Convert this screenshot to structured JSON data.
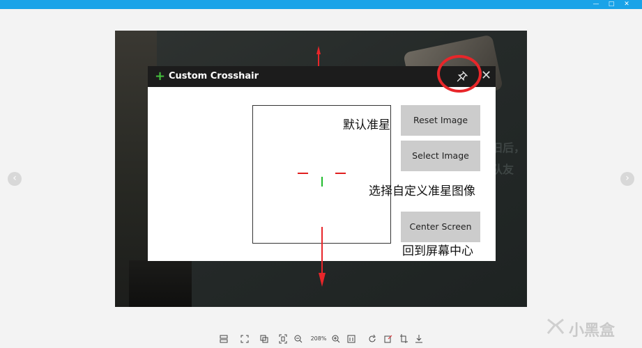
{
  "window": {
    "controls": [
      "—",
      "□",
      "✕"
    ]
  },
  "viewer": {
    "prev_glyph": "‹",
    "next_glyph": "›",
    "zoom_level": "208%",
    "watermark": "小黑盒"
  },
  "photo_bg": {
    "text1": "旧后，",
    "text2": "队友"
  },
  "app": {
    "title": "Custom Crosshair",
    "icon": "plus-icon",
    "pin_icon": "pin-icon",
    "close_glyph": "✕",
    "buttons": {
      "reset": "Reset Image",
      "select": "Select Image",
      "center": "Center Screen"
    }
  },
  "annotations": {
    "default_crosshair": "默认准星",
    "select_custom": "选择自定义准星图像",
    "center_screen": "回到屏幕中心"
  },
  "colors": {
    "accent": "#1aa3e8",
    "plus_green": "#44c23d",
    "annotation_red": "#e8262a",
    "crosshair_red": "#e01f1f",
    "crosshair_green": "#1fbb2c"
  }
}
